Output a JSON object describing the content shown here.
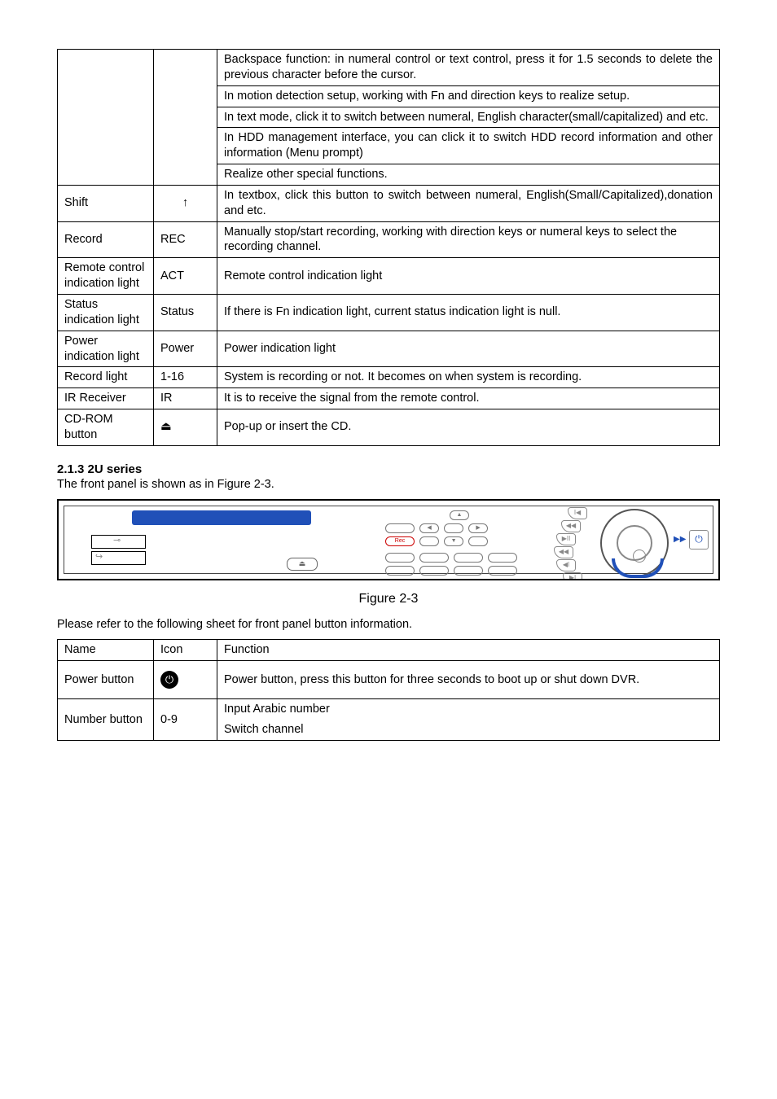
{
  "table1": {
    "r1": {
      "d1": "Backspace function: in numeral control or text control, press it for 1.5 seconds to delete the previous character before the cursor.",
      "d2": "In motion detection setup, working with Fn and direction keys to realize setup.",
      "d3": "In text mode, click it to switch between numeral, English character(small/capitalized) and etc.",
      "d4": "In HDD management interface, you can click it to switch HDD record information and other information (Menu prompt)",
      "d5": "Realize other special functions."
    },
    "shift": {
      "name": "Shift",
      "icon": "↑",
      "desc": "In textbox, click this button to switch between numeral, English(Small/Capitalized),donation and etc."
    },
    "record": {
      "name": "Record",
      "icon": "REC",
      "desc": "Manually stop/start recording, working with direction keys or numeral keys to select the recording channel."
    },
    "remote": {
      "name": "Remote control indication light",
      "icon": "ACT",
      "desc": "Remote control indication light"
    },
    "status": {
      "name": "Status indication light",
      "icon": "Status",
      "desc": "If there is Fn indication light, current status indication light is null."
    },
    "power": {
      "name": "Power indication light",
      "icon": "Power",
      "desc": "Power indication light"
    },
    "reclight": {
      "name": "Record light",
      "icon": "1-16",
      "desc": "System is recording or not. It becomes on when system is recording."
    },
    "ir": {
      "name": "IR Receiver",
      "icon": "IR",
      "desc": "It is to receive the signal from the remote control."
    },
    "cdrom": {
      "name": "CD-ROM button",
      "icon": "⏏",
      "desc": "Pop-up or insert the CD."
    }
  },
  "section": {
    "heading": "2.1.3  2U series",
    "intro": "The front panel is shown as in Figure 2-3.",
    "caption": "Figure 2-3",
    "tableNote": "Please refer to the following sheet for front panel button information."
  },
  "table2": {
    "header": {
      "c1": "Name",
      "c2": "Icon",
      "c3": "Function"
    },
    "power": {
      "name": "Power button",
      "icon": "⏻",
      "desc": "Power button, press this button for three seconds to boot up or shut down DVR."
    },
    "number": {
      "name": "Number button",
      "icon": "0-9",
      "d1": "Input Arabic number",
      "d2": "Switch channel"
    }
  },
  "panel": {
    "eject": "⏏",
    "rec": "Rec",
    "power": "⏻"
  }
}
